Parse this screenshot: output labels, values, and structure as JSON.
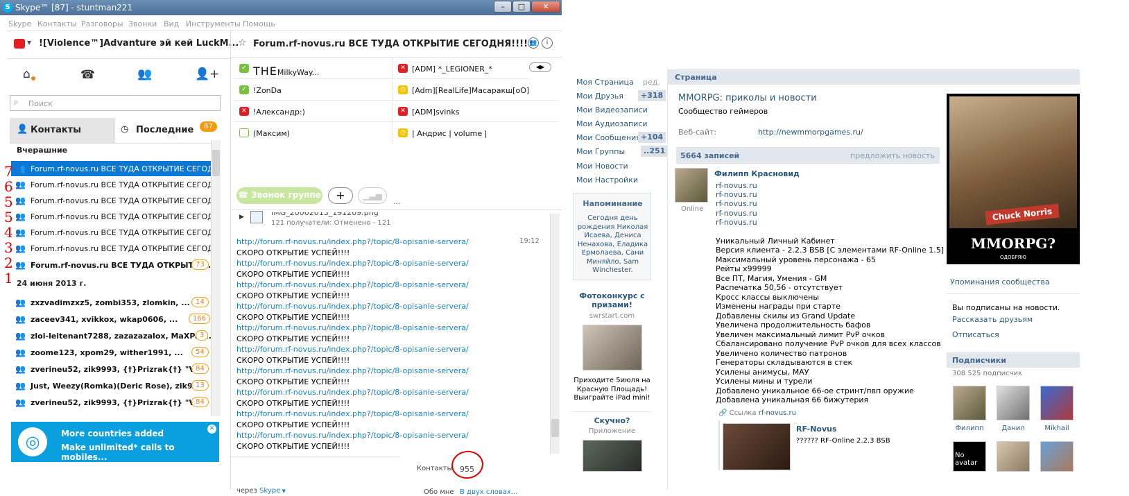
{
  "window": {
    "title": "Skype™ [87] - stuntman221",
    "min": "–",
    "max": "□",
    "close": "✕"
  },
  "menu": [
    "Skype",
    "Контакты",
    "Разговоры",
    "Звонки",
    "Вид",
    "Инструменты",
    "Помощь"
  ],
  "profile": {
    "name": "![Violence™]Advanture эй кей LuckM..."
  },
  "search": {
    "placeholder": "Поиск"
  },
  "tabs": {
    "contacts": "Контакты",
    "recent": "Последние",
    "recent_badge": "87"
  },
  "recent": {
    "group1": "Вчерашние",
    "group2": "24 июня 2013 г.",
    "items1": [
      {
        "label": "Forum.rf-novus.ru ВСЕ ТУДА ОТКРЫТИЕ СЕГОДНЯ..."
      },
      {
        "label": "Forum.rf-novus.ru ВСЕ ТУДА ОТКРЫТИЕ СЕГОДНЯ..."
      },
      {
        "label": "Forum.rf-novus.ru ВСЕ ТУДА ОТКРЫТИЕ СЕГОДНЯ..."
      },
      {
        "label": "Forum.rf-novus.ru ВСЕ ТУДА ОТКРЫТИЕ СЕГОДНЯ..."
      },
      {
        "label": "Forum.rf-novus.ru ВСЕ ТУДА ОТКРЫТИЕ СЕГОДНЯ..."
      },
      {
        "label": "Forum.rf-novus.ru ВСЕ ТУДА ОТКРЫТИЕ СЕГОДНЯ..."
      },
      {
        "label": "Forum.rf-novus.ru ВСЕ ТУДА ОТКРЫТИЕ...",
        "badge": "73"
      }
    ],
    "items2": [
      {
        "label": "zxzvadimzxz5, zombi353, zlomkin, ...",
        "badge": "14"
      },
      {
        "label": "zaceev341, xvikkox, wkap0606, ...",
        "badge": "166"
      },
      {
        "label": "zloi-leitenant7288, zazazazalox, MaXPar...",
        "badge": "3"
      },
      {
        "label": "zoome123, xpom29, wither1991, ...",
        "badge": "54"
      },
      {
        "label": "zverineu52, zik9993, {†}Prizrak{†} \"VL...",
        "badge": "84"
      },
      {
        "label": "Just, Weezy(Romka)(Deric Rose), zik99...",
        "badge": "13"
      },
      {
        "label": "zverineu52, zik9993, {†}Prizrak{†} \"VL...",
        "badge": "84"
      }
    ]
  },
  "ad": {
    "title": "More countries added",
    "sub": "Make unlimited* calls to mobiles..."
  },
  "chat": {
    "title": "Forum.rf-novus.ru ВСЕ ТУДА ОТКРЫТИЕ СЕГОДНЯ!!!!",
    "participants": [
      {
        "name": "MilkyWay...",
        "prefix": "THE",
        "status": "online"
      },
      {
        "name": "[ADM] *_LEGIONER_*",
        "status": "offline"
      },
      {
        "name": "!ZonDa",
        "status": "online"
      },
      {
        "name": "[Adm][RealLife]Масаракш[oO]",
        "status": "away"
      },
      {
        "name": "!Александр:)",
        "status": "offline"
      },
      {
        "name": "[ADM]svinks",
        "status": "offline"
      },
      {
        "name": "(Максим)",
        "status": "offline-hollow"
      },
      {
        "name": "| Андрис | volume |",
        "status": "away"
      }
    ],
    "call_button": "Звонок группе",
    "file_msg": "121 получатели: Отменено - 121",
    "file_name": "IMG_20062013_191209.png",
    "time": "19:12",
    "link": "http://forum.rf-novus.ru/index.php?/topic/8-opisanie-servera/",
    "text": "СКОРО ОТКРЫТИЕ УСПЕЙ!!!!",
    "via": "через",
    "via_app": "Skype",
    "contacts_label": "Контакты",
    "contacts_count": "955",
    "about_me": "Обо мне",
    "about_short": "В двух словах..."
  },
  "vk": {
    "menu": [
      {
        "label": "Моя Страница",
        "extra": "ред."
      },
      {
        "label": "Мои Друзья",
        "count": "+318"
      },
      {
        "label": "Мои Видеозаписи"
      },
      {
        "label": "Мои Аудиозаписи"
      },
      {
        "label": "Мои Сообщения",
        "count": "+104"
      },
      {
        "label": "Мои Группы",
        "count": "..251"
      },
      {
        "label": "Мои Новости"
      },
      {
        "label": "Мои Настройки"
      }
    ],
    "reminder": {
      "title": "Напоминание",
      "lines": [
        "Сегодня день",
        "рождения Николая",
        "Исаева, Дениса",
        "Ненахова, Еладика",
        "Ермолаева, Сани",
        "Миняйло, Sam",
        "Winchester."
      ]
    },
    "contest": {
      "title": "Фотоконкурс с призами!",
      "domain": "swrstart.com",
      "text": [
        "Приходите 5июля на",
        "Красную Площадь!",
        "Выиграйте iPad mini!"
      ]
    },
    "boring": {
      "title": "Скучно?",
      "sub": "Приложение"
    },
    "page_header": "Страница",
    "group_name": "MMORPG: приколы и новости",
    "group_desc": "Сообщество геймеров",
    "website_label": "Веб-сайт:",
    "website": "http://newmmorpgames.ru/",
    "posts_count": "5664 записей",
    "suggest": "предложить новость",
    "post": {
      "author": "Филипп Красновид",
      "online": "Online",
      "links": [
        "rf-novus.ru",
        "rf-novus.ru",
        "rf-novus.ru",
        "rf-novus.ru",
        "rf-novus.ru"
      ],
      "lines": [
        "Уникальный Личный Кабинет",
        "Версия клиента - 2.2.3 BSB [С элементами RF-Online 1.5]",
        "Максимальный уровень персонажа - 65",
        "Рейты x99999",
        "Все ПТ, Магия, Умения - GM",
        "Распечатка 50,56 - отсутствует",
        "Кросс классы выключены",
        "Изменены награды при старте",
        "Добавлены скилы из Grand Update",
        "Увеличена продолжительность бафов",
        "Увеличен максимальный лимит PvP очков",
        "Сбалансировано получение PvP очков для всех классов",
        "Увеличено количество патронов",
        "Генераторы складываются в стек",
        "Усилены анимусы, МАУ",
        "Усилены мины и турели",
        "Добавлено уникальное 66-ое стринт/пвп оружие",
        "Добавлена уникальная 66 бижутерия"
      ],
      "ref_label": "Ссылка",
      "ref": "rf-novus.ru",
      "share_title": "RF-Novus",
      "share_text": "?????? RF-Online 2.2.3 BSB"
    },
    "poster": {
      "name": "Chuck Norris",
      "title": "MMORPG?",
      "sub": "ОДОБРЯЮ"
    },
    "mentions": "Упоминания сообщества",
    "subscribed": "Вы подписаны на новости.",
    "tell": "Рассказать друзьям",
    "unsubscribe": "Отписаться",
    "subs_header": "Подписчики",
    "subs_count": "308 525 подписчик",
    "subs": [
      "Филипп",
      "Данил",
      "Mikhail",
      "No avatar",
      "",
      ""
    ]
  },
  "annotation": {
    "numbers": [
      "7",
      "6",
      "5",
      "5",
      "4",
      "3",
      "2",
      "1"
    ]
  }
}
